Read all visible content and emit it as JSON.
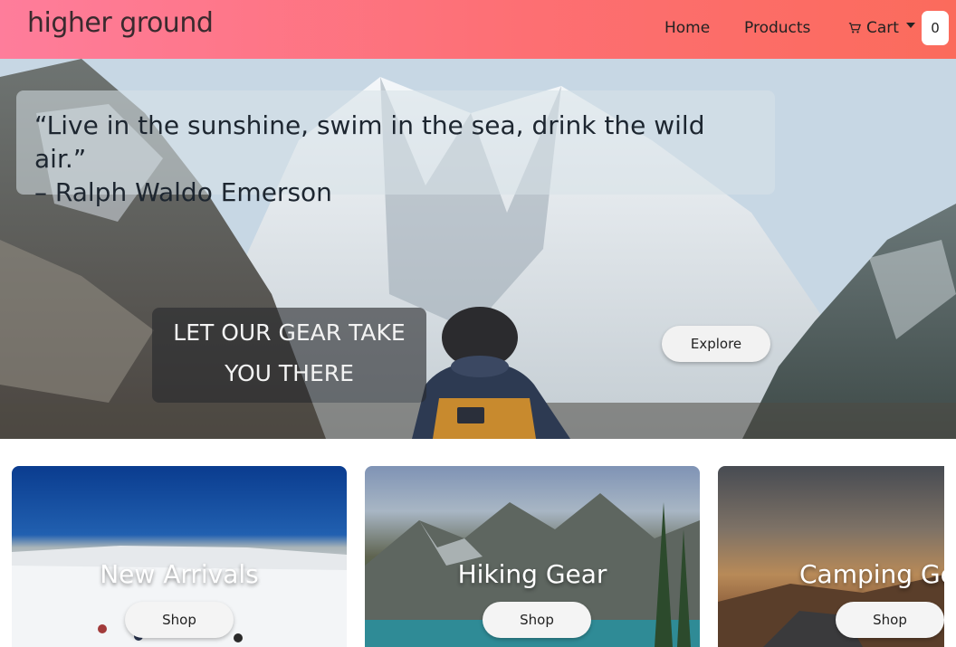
{
  "navbar": {
    "brand": "higher ground",
    "links": [
      {
        "label": "Home"
      },
      {
        "label": "Products"
      },
      {
        "label": "Cart"
      }
    ],
    "cart_count": "0"
  },
  "hero": {
    "quote_line1": "“Live in the sunshine, swim in the sea, drink the wild air.”",
    "quote_line2": "– Ralph Waldo Emerson",
    "tagline_line1": "LET OUR GEAR TAKE",
    "tagline_line2": "YOU THERE",
    "explore_label": "Explore"
  },
  "cards": [
    {
      "title": "New Arrivals",
      "button": "Shop"
    },
    {
      "title": "Hiking Gear",
      "button": "Shop"
    },
    {
      "title": "Camping Gear",
      "button": "Shop"
    }
  ],
  "colors": {
    "navbar_gradient_start": "#fe7d9b",
    "navbar_gradient_end": "#fb6b5c",
    "button_bg": "#f2f2f2"
  },
  "icons": {
    "cart": "cart-icon",
    "dropdown": "chevron-down-icon"
  }
}
